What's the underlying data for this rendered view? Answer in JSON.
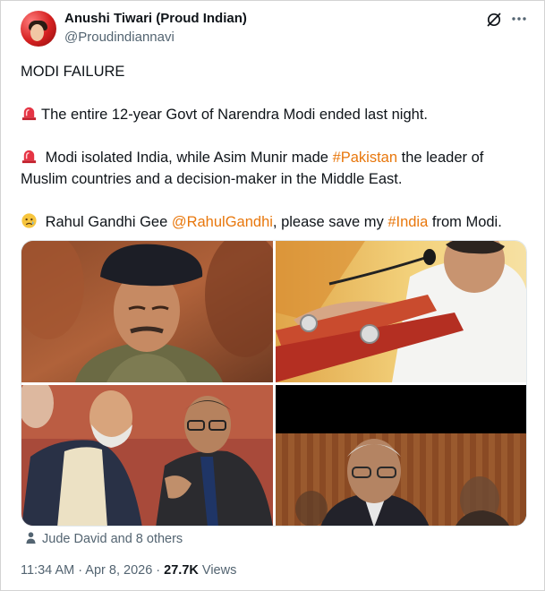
{
  "author": {
    "display_name": "Anushi Tiwari (Proud Indian)",
    "handle": "@Proudindiannavi"
  },
  "header_icons": [
    "grok-icon",
    "more-icon"
  ],
  "tweet": {
    "line1": "MODI FAILURE",
    "line2": {
      "emoji": "rotating-light-emoji",
      "text": "The entire 12-year Govt  of Narendra Modi ended last night."
    },
    "line3": {
      "emoji": "rotating-light-emoji",
      "text_a": " Modi isolated India, while Asim Munir made ",
      "hashtag": "#Pakistan",
      "text_b": " the leader of Muslim countries and a decision-maker in the Middle East."
    },
    "line4": {
      "emoji": "crying-face-emoji",
      "text_a": " Rahul Gandhi Gee ",
      "mention": "@RahulGandhi",
      "text_b": ", please save my ",
      "hashtag": "#India",
      "text_c": " from Modi."
    }
  },
  "media": {
    "photos": [
      "photo-general-cap",
      "photo-speaker-podium",
      "photo-two-men-talking",
      "photo-man-glasses"
    ]
  },
  "tagged": {
    "icon": "person-icon",
    "text": "Jude David and 8 others"
  },
  "meta": {
    "time": "11:34 AM",
    "separator": " · ",
    "date": "Apr 8, 2026",
    "views_count": "27.7K",
    "views_label": " Views"
  },
  "colors": {
    "link": "#e8770c",
    "secondary_text": "#536471",
    "primary_text": "#0f1419"
  }
}
